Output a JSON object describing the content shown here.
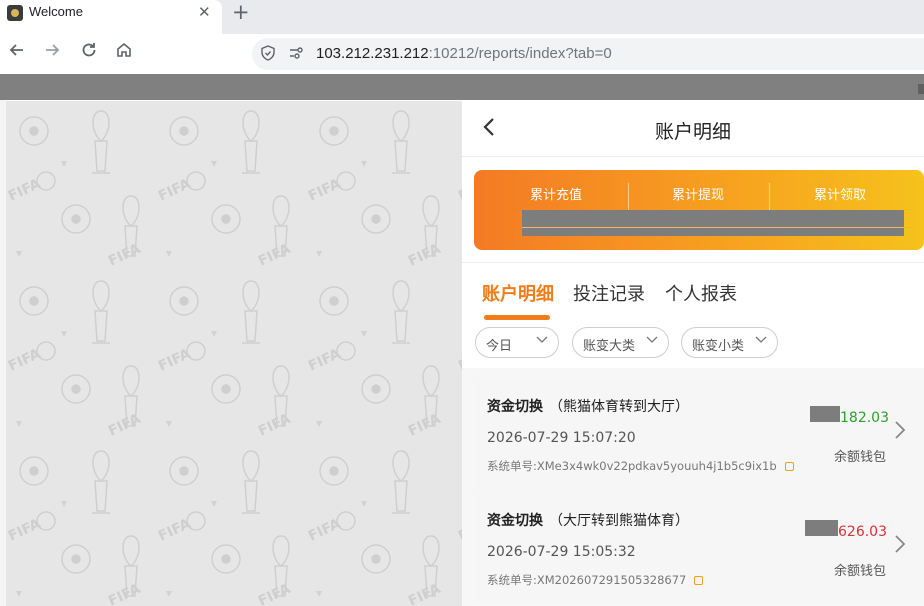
{
  "browser": {
    "tab_title": "Welcome",
    "tab_close": "✕",
    "new_tab": "+",
    "url_host": "103.212.231.212",
    "url_rest": ":10212/reports/index?tab=0"
  },
  "panel": {
    "back": "‹",
    "title": "账户明细"
  },
  "stats": {
    "items": [
      {
        "label": "累计充值"
      },
      {
        "label": "累计提现"
      },
      {
        "label": "累计领取"
      }
    ]
  },
  "content_tabs": [
    {
      "label": "账户明细",
      "active": true
    },
    {
      "label": "投注记录",
      "active": false
    },
    {
      "label": "个人报表",
      "active": false
    }
  ],
  "filters": [
    {
      "label": "今日"
    },
    {
      "label": "账变大类"
    },
    {
      "label": "账变小类"
    }
  ],
  "records": [
    {
      "title": "资金切换",
      "subtitle": "（熊猫体育转到大厅）",
      "time": "2026-07-29 15:07:20",
      "order_label": "系统单号:",
      "order_no": "XMe3x4wk0v22pdkav5youuh4j1b5c9ix1b",
      "amount": "182.03",
      "amount_color": "#2aa12a",
      "wallet": "余额钱包"
    },
    {
      "title": "资金切换",
      "subtitle": "（大厅转到熊猫体育）",
      "time": "2026-07-29 15:05:32",
      "order_label": "系统单号:",
      "order_no": "XM202607291505328677",
      "amount": "626.03",
      "amount_color": "#d9313a",
      "wallet": "余额钱包"
    }
  ],
  "colors": {
    "accent": "#f07d1a",
    "gradient_start": "#f47a25",
    "gradient_end": "#f6c21c"
  }
}
